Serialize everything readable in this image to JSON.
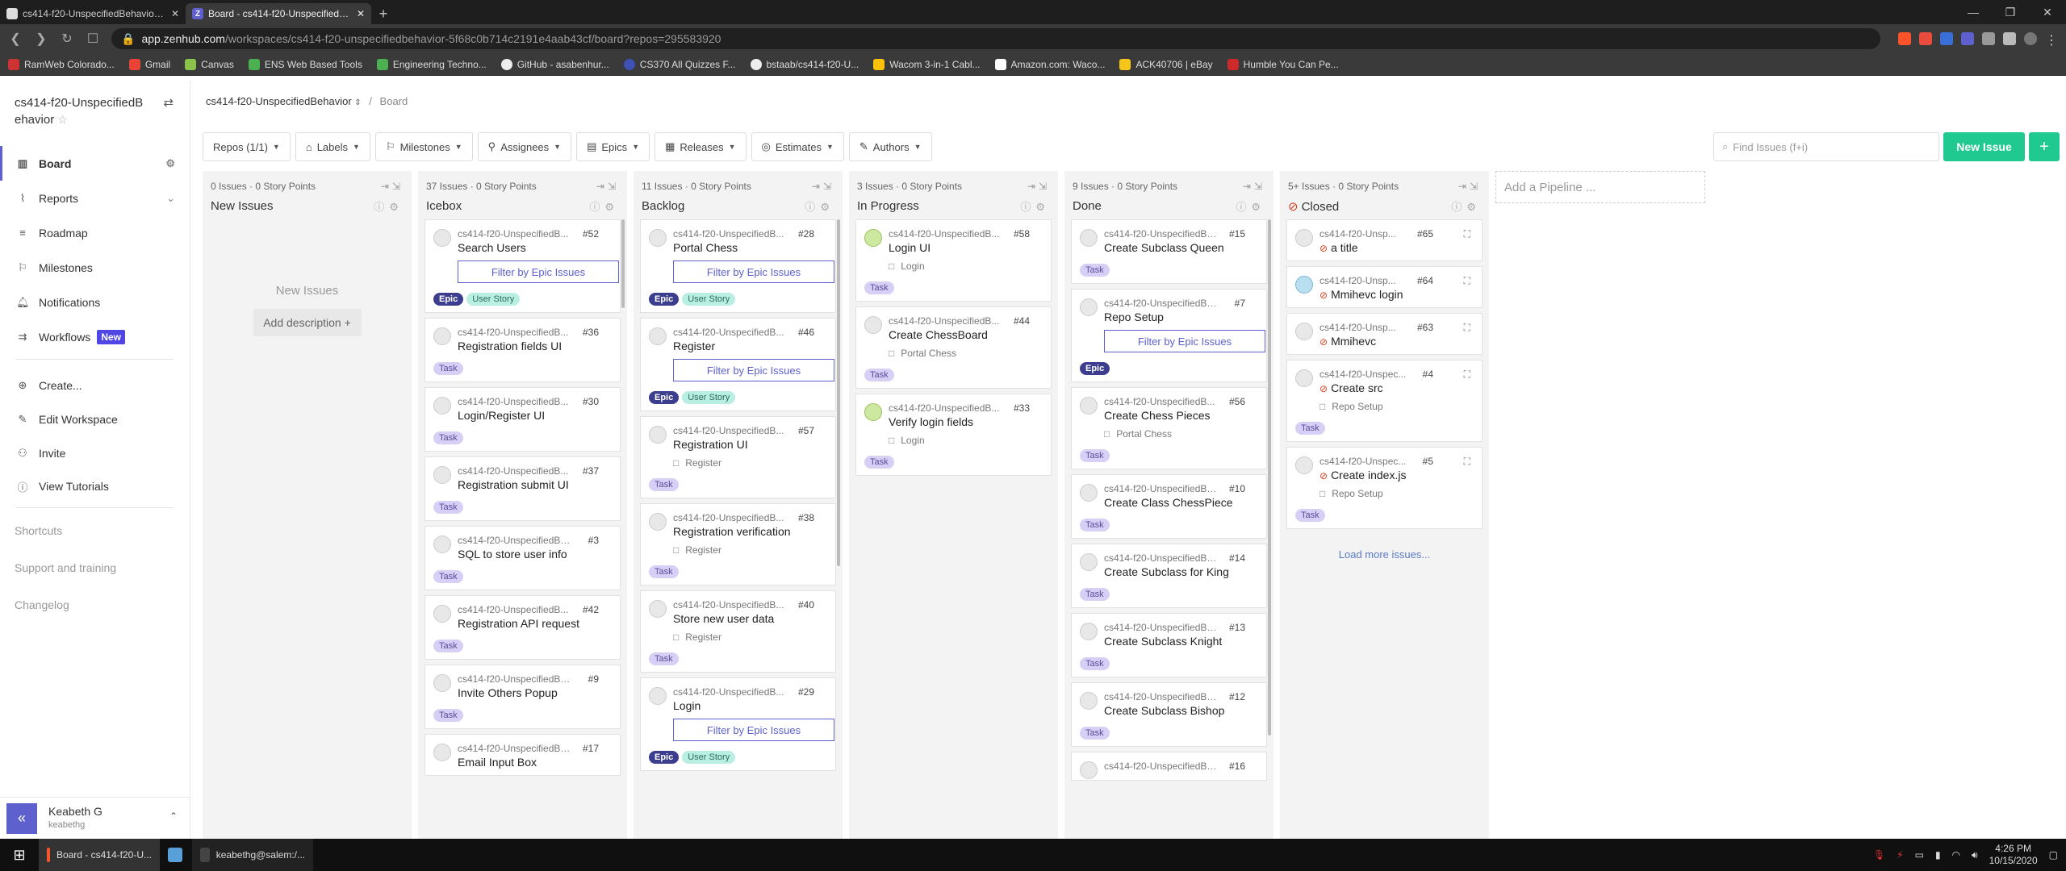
{
  "browser": {
    "tabs": [
      {
        "title": "cs414-f20-UnspecifiedBehavior/ze",
        "icon": "github-icon"
      },
      {
        "title": "Board - cs414-f20-UnspecifiedBehav",
        "icon": "zenhub-icon"
      }
    ],
    "url_host": "app.zenhub.com",
    "url_path": "/workspaces/cs414-f20-unspecifiedbehavior-5f68c0b714c2191e4aab43cf/board?repos=295583920",
    "bookmarks": [
      "RamWeb Colorado...",
      "Gmail",
      "Canvas",
      "ENS Web Based Tools",
      "Engineering Techno...",
      "GitHub - asabenhur...",
      "CS370 All Quizzes F...",
      "bstaab/cs414-f20-U...",
      "Wacom 3-in-1 Cabl...",
      "Amazon.com: Waco...",
      "ACK40706 | eBay",
      "Humble You Can Pe..."
    ],
    "extension_badge": "8"
  },
  "sidebar": {
    "workspace": "cs414-f20-UnspecifiedBehavior",
    "items": [
      {
        "label": "Board",
        "icon": "board-icon"
      },
      {
        "label": "Reports",
        "icon": "reports-icon"
      },
      {
        "label": "Roadmap",
        "icon": "roadmap-icon"
      },
      {
        "label": "Milestones",
        "icon": "milestones-icon"
      },
      {
        "label": "Notifications",
        "icon": "bell-icon"
      },
      {
        "label": "Workflows",
        "icon": "workflows-icon",
        "badge": "New"
      }
    ],
    "actions": [
      {
        "label": "Create...",
        "icon": "plus-circle-icon"
      },
      {
        "label": "Edit Workspace",
        "icon": "edit-icon"
      },
      {
        "label": "Invite",
        "icon": "invite-icon"
      },
      {
        "label": "View Tutorials",
        "icon": "info-icon"
      }
    ],
    "links": [
      "Shortcuts",
      "Support and training",
      "Changelog"
    ],
    "user": {
      "name": "Keabeth G",
      "handle": "keabethg"
    }
  },
  "header": {
    "breadcrumb_repo": "cs414-f20-UnspecifiedBehavior",
    "breadcrumb_page": "Board",
    "filters": [
      "Repos (1/1)",
      "Labels",
      "Milestones",
      "Assignees",
      "Epics",
      "Releases",
      "Estimates",
      "Authors"
    ],
    "search_placeholder": "Find Issues (f+i)",
    "new_issue": "New Issue",
    "add_pipeline": "Add a Pipeline ..."
  },
  "pipelines": [
    {
      "meta": "0 Issues · 0 Story Points",
      "name": "New Issues",
      "empty_text": "New Issues",
      "add_desc": "Add description +",
      "cards": []
    },
    {
      "meta": "37 Issues · 0 Story Points",
      "name": "Icebox",
      "cards": [
        {
          "repo": "cs414-f20-UnspecifiedB...",
          "num": "#52",
          "title": "Search Users",
          "filter": "Filter by Epic Issues",
          "labels": [
            "Epic",
            "User Story"
          ]
        },
        {
          "repo": "cs414-f20-UnspecifiedB...",
          "num": "#36",
          "title": "Registration fields UI",
          "labels": [
            "Task"
          ]
        },
        {
          "repo": "cs414-f20-UnspecifiedB...",
          "num": "#30",
          "title": "Login/Register UI",
          "labels": [
            "Task"
          ]
        },
        {
          "repo": "cs414-f20-UnspecifiedB...",
          "num": "#37",
          "title": "Registration submit UI",
          "labels": [
            "Task"
          ]
        },
        {
          "repo": "cs414-f20-UnspecifiedBe...",
          "num": "#3",
          "title": "SQL to store user info",
          "labels": [
            "Task"
          ]
        },
        {
          "repo": "cs414-f20-UnspecifiedB...",
          "num": "#42",
          "title": "Registration API request",
          "labels": [
            "Task"
          ]
        },
        {
          "repo": "cs414-f20-UnspecifiedBe...",
          "num": "#9",
          "title": "Invite Others Popup",
          "labels": [
            "Task"
          ]
        },
        {
          "repo": "cs414-f20-UnspecifiedBe...",
          "num": "#17",
          "title": "Email Input Box",
          "labels": []
        }
      ]
    },
    {
      "meta": "11 Issues · 0 Story Points",
      "name": "Backlog",
      "cards": [
        {
          "repo": "cs414-f20-UnspecifiedB...",
          "num": "#28",
          "title": "Portal Chess",
          "filter": "Filter by Epic Issues",
          "labels": [
            "Epic",
            "User Story"
          ]
        },
        {
          "repo": "cs414-f20-UnspecifiedB...",
          "num": "#46",
          "title": "Register",
          "filter": "Filter by Epic Issues",
          "labels": [
            "Epic",
            "User Story"
          ]
        },
        {
          "repo": "cs414-f20-UnspecifiedB...",
          "num": "#57",
          "title": "Registration UI",
          "epic": "Register",
          "labels": [
            "Task"
          ]
        },
        {
          "repo": "cs414-f20-UnspecifiedB...",
          "num": "#38",
          "title": "Registration verification",
          "epic": "Register",
          "labels": [
            "Task"
          ]
        },
        {
          "repo": "cs414-f20-UnspecifiedB...",
          "num": "#40",
          "title": "Store new user data",
          "epic": "Register",
          "labels": [
            "Task"
          ]
        },
        {
          "repo": "cs414-f20-UnspecifiedB...",
          "num": "#29",
          "title": "Login",
          "filter": "Filter by Epic Issues",
          "labels": [
            "Epic",
            "User Story"
          ]
        }
      ]
    },
    {
      "meta": "3 Issues · 0 Story Points",
      "name": "In Progress",
      "cards": [
        {
          "repo": "cs414-f20-UnspecifiedB...",
          "num": "#58",
          "title": "Login UI",
          "epic": "Login",
          "labels": [
            "Task"
          ],
          "avatar": "g"
        },
        {
          "repo": "cs414-f20-UnspecifiedB...",
          "num": "#44",
          "title": "Create ChessBoard",
          "epic": "Portal Chess",
          "labels": [
            "Task"
          ]
        },
        {
          "repo": "cs414-f20-UnspecifiedB...",
          "num": "#33",
          "title": "Verify login fields",
          "epic": "Login",
          "labels": [
            "Task"
          ],
          "avatar": "g"
        }
      ]
    },
    {
      "meta": "9 Issues · 0 Story Points",
      "name": "Done",
      "cards": [
        {
          "repo": "cs414-f20-UnspecifiedBe...",
          "num": "#15",
          "title": "Create Subclass Queen",
          "labels": [
            "Task"
          ]
        },
        {
          "repo": "cs414-f20-UnspecifiedBe...",
          "num": "#7",
          "title": "Repo Setup",
          "filter": "Filter by Epic Issues",
          "labels": [
            "Epic"
          ]
        },
        {
          "repo": "cs414-f20-UnspecifiedB...",
          "num": "#56",
          "title": "Create Chess Pieces",
          "epic": "Portal Chess",
          "labels": [
            "Task"
          ]
        },
        {
          "repo": "cs414-f20-UnspecifiedBe...",
          "num": "#10",
          "title": "Create Class ChessPiece",
          "labels": [
            "Task"
          ]
        },
        {
          "repo": "cs414-f20-UnspecifiedBe...",
          "num": "#14",
          "title": "Create Subclass for King",
          "labels": [
            "Task"
          ]
        },
        {
          "repo": "cs414-f20-UnspecifiedBe...",
          "num": "#13",
          "title": "Create Subclass Knight",
          "labels": [
            "Task"
          ]
        },
        {
          "repo": "cs414-f20-UnspecifiedBe...",
          "num": "#12",
          "title": "Create Subclass Bishop",
          "labels": [
            "Task"
          ]
        },
        {
          "repo": "cs414-f20-UnspecifiedBe...",
          "num": "#16",
          "title": "",
          "labels": []
        }
      ]
    },
    {
      "meta": "5+ Issues · 0 Story Points",
      "name": "Closed",
      "closed": true,
      "load_more": "Load more issues...",
      "cards": [
        {
          "repo": "cs414-f20-Unsp...",
          "num": "#65",
          "title": "a title",
          "closed": true,
          "labels": []
        },
        {
          "repo": "cs414-f20-Unsp...",
          "num": "#64",
          "title": "Mmihevc login",
          "closed": true,
          "labels": [],
          "avatar": "p"
        },
        {
          "repo": "cs414-f20-Unsp...",
          "num": "#63",
          "title": "Mmihevc",
          "closed": true,
          "labels": []
        },
        {
          "repo": "cs414-f20-Unspec...",
          "num": "#4",
          "title": "Create src",
          "epic": "Repo Setup",
          "closed": true,
          "labels": [
            "Task"
          ]
        },
        {
          "repo": "cs414-f20-Unspec...",
          "num": "#5",
          "title": "Create index.js",
          "epic": "Repo Setup",
          "closed": true,
          "labels": [
            "Task"
          ]
        }
      ]
    }
  ],
  "taskbar": {
    "items": [
      "Board - cs414-f20-U...",
      "keabethg@salem:/..."
    ],
    "time": "4:26 PM",
    "date": "10/15/2020"
  },
  "colors": {
    "accent": "#5e60ce",
    "new_issue": "#1fc98f",
    "closed": "#d9411e"
  }
}
